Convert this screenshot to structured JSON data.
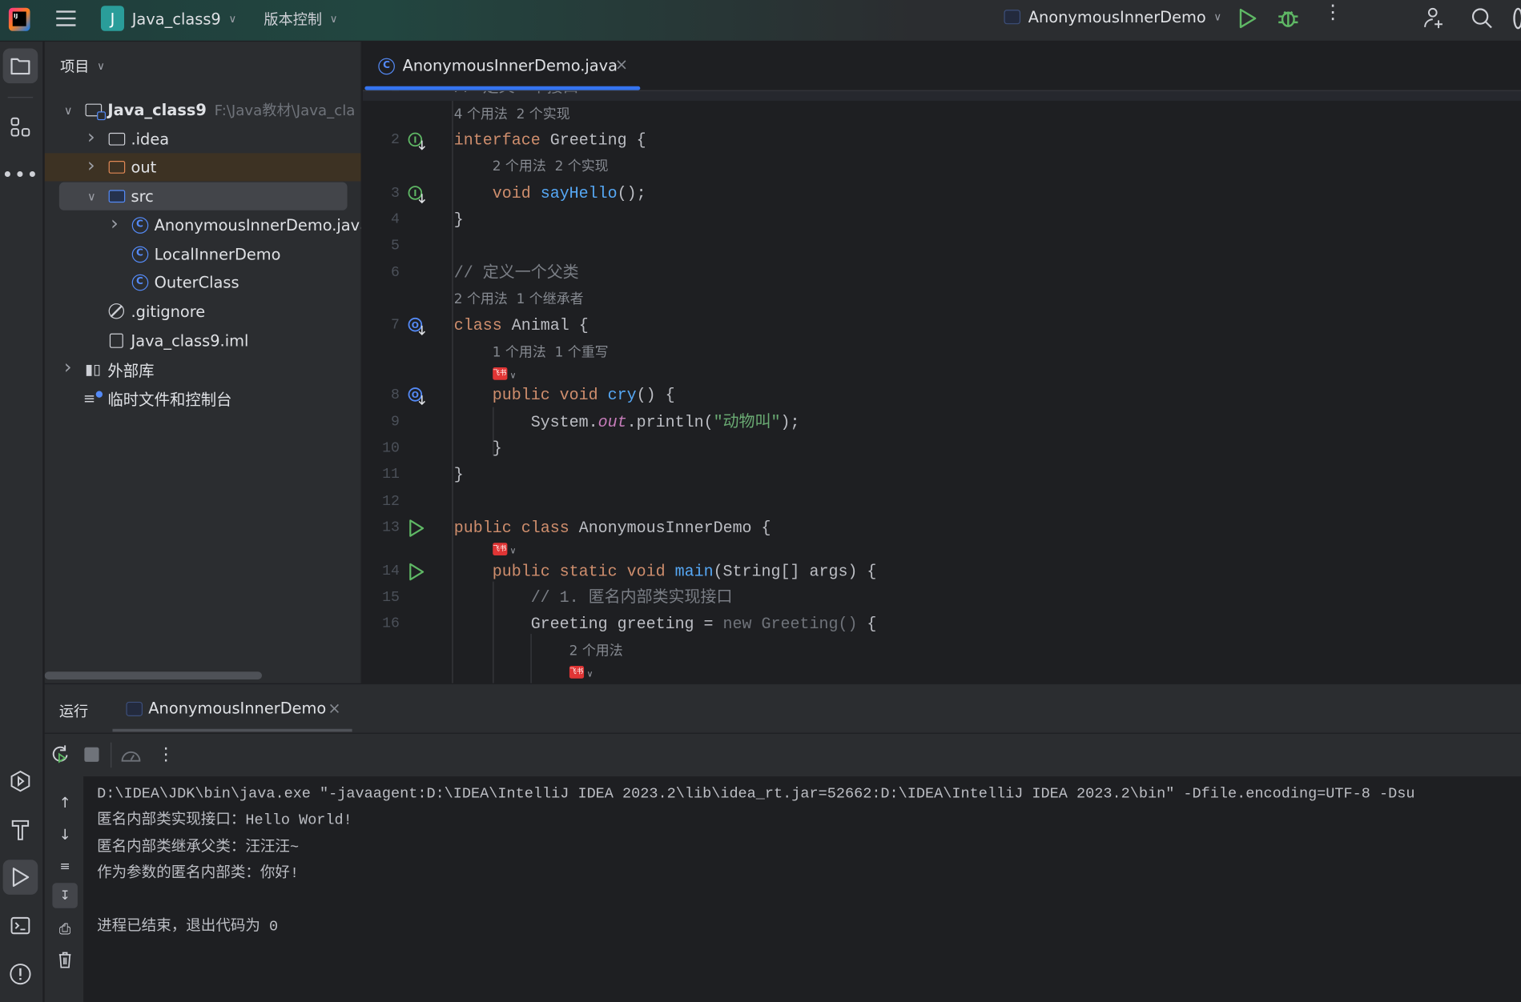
{
  "titlebar": {
    "project_badge": "J",
    "project_name": "Java_class9",
    "vcs_label": "版本控制",
    "run_config": "AnonymousInnerDemo",
    "accent_green": "#5fb865"
  },
  "project_panel": {
    "title": "项目",
    "tree": [
      {
        "label": "Java_class9",
        "path": "F:\\Java教材\\Java_cla",
        "level": 0,
        "expanded": true,
        "icon": "module-folder-icon"
      },
      {
        "label": ".idea",
        "level": 1,
        "expanded": false,
        "icon": "folder-icon"
      },
      {
        "label": "out",
        "level": 1,
        "expanded": false,
        "icon": "excluded-folder-icon",
        "highlight": "excluded"
      },
      {
        "label": "src",
        "level": 1,
        "expanded": true,
        "icon": "source-folder-icon",
        "selected": true
      },
      {
        "label": "AnonymousInnerDemo.java",
        "level": 2,
        "expanded": false,
        "icon": "class-icon",
        "has_children": true
      },
      {
        "label": "LocalInnerDemo",
        "level": 2,
        "icon": "class-icon"
      },
      {
        "label": "OuterClass",
        "level": 2,
        "icon": "class-icon"
      },
      {
        "label": ".gitignore",
        "level": 1,
        "icon": "ignore-file-icon"
      },
      {
        "label": "Java_class9.iml",
        "level": 1,
        "icon": "iml-file-icon"
      },
      {
        "label": "外部库",
        "level": 0,
        "expanded": false,
        "icon": "library-icon"
      },
      {
        "label": "临时文件和控制台",
        "level": 0,
        "icon": "scratches-icon"
      }
    ]
  },
  "editor": {
    "tab_label": "AnonymousInnerDemo.java",
    "rows": [
      {
        "kind": "code",
        "line": "1",
        "indent": 0,
        "tokens": [
          {
            "c": "cm",
            "v": "// 定义一个接口"
          }
        ]
      },
      {
        "kind": "hint",
        "indent": 0,
        "tokens": [
          {
            "c": "hint",
            "v": "4 个用法  2 个实现"
          }
        ]
      },
      {
        "kind": "code",
        "line": "2",
        "gutter": "implemented-icon",
        "indent": 0,
        "tokens": [
          {
            "c": "kw",
            "v": "interface "
          },
          {
            "c": "tx",
            "v": "Greeting {"
          }
        ]
      },
      {
        "kind": "hint",
        "indent": 1,
        "tokens": [
          {
            "c": "hint",
            "v": "2 个用法  2 个实现"
          }
        ]
      },
      {
        "kind": "code",
        "line": "3",
        "gutter": "implemented-icon",
        "indent": 1,
        "tokens": [
          {
            "c": "kw",
            "v": "void "
          },
          {
            "c": "fn",
            "v": "sayHello"
          },
          {
            "c": "tx",
            "v": "();"
          }
        ]
      },
      {
        "kind": "code",
        "line": "4",
        "indent": 0,
        "tokens": [
          {
            "c": "tx",
            "v": "}"
          }
        ]
      },
      {
        "kind": "code",
        "line": "5",
        "indent": 0,
        "tokens": []
      },
      {
        "kind": "code",
        "line": "6",
        "indent": 0,
        "tokens": [
          {
            "c": "cm",
            "v": "// 定义一个父类"
          }
        ]
      },
      {
        "kind": "hint",
        "indent": 0,
        "tokens": [
          {
            "c": "hint",
            "v": "2 个用法  1 个继承者"
          }
        ]
      },
      {
        "kind": "code",
        "line": "7",
        "gutter": "overridden-icon",
        "indent": 0,
        "tokens": [
          {
            "c": "kw",
            "v": "class "
          },
          {
            "c": "tx",
            "v": "Animal {"
          }
        ]
      },
      {
        "kind": "hint",
        "indent": 1,
        "tokens": [
          {
            "c": "hint",
            "v": "1 个用法  1 个重写"
          }
        ]
      },
      {
        "kind": "badge",
        "indent": 1,
        "badge_text": "飞书"
      },
      {
        "kind": "code",
        "line": "8",
        "gutter": "overridden-icon",
        "indent": 1,
        "tokens": [
          {
            "c": "kw",
            "v": "public void "
          },
          {
            "c": "fn",
            "v": "cry"
          },
          {
            "c": "tx",
            "v": "() {"
          }
        ]
      },
      {
        "kind": "code",
        "line": "9",
        "indent": 2,
        "tokens": [
          {
            "c": "tx",
            "v": "System."
          },
          {
            "c": "sf",
            "v": "out"
          },
          {
            "c": "tx",
            "v": ".println("
          },
          {
            "c": "st",
            "v": "\"动物叫\""
          },
          {
            "c": "tx",
            "v": ");"
          }
        ]
      },
      {
        "kind": "code",
        "line": "10",
        "indent": 1,
        "tokens": [
          {
            "c": "tx",
            "v": "}"
          }
        ]
      },
      {
        "kind": "code",
        "line": "11",
        "indent": 0,
        "tokens": [
          {
            "c": "tx",
            "v": "}"
          }
        ]
      },
      {
        "kind": "code",
        "line": "12",
        "indent": 0,
        "tokens": []
      },
      {
        "kind": "code",
        "line": "13",
        "gutter": "run-icon",
        "indent": 0,
        "tokens": [
          {
            "c": "kw",
            "v": "public class "
          },
          {
            "c": "tx",
            "v": "AnonymousInnerDemo {"
          }
        ]
      },
      {
        "kind": "badge",
        "indent": 1,
        "badge_text": "飞书"
      },
      {
        "kind": "code",
        "line": "14",
        "gutter": "run-icon",
        "indent": 1,
        "tokens": [
          {
            "c": "kw",
            "v": "public static void "
          },
          {
            "c": "fn",
            "v": "main"
          },
          {
            "c": "tx",
            "v": "(String[] args) {"
          }
        ]
      },
      {
        "kind": "code",
        "line": "15",
        "indent": 2,
        "tokens": [
          {
            "c": "cm",
            "v": "// 1. 匿名内部类实现接口"
          }
        ]
      },
      {
        "kind": "code",
        "line": "16",
        "indent": 2,
        "tokens": [
          {
            "c": "tx",
            "v": "Greeting greeting = "
          },
          {
            "c": "dim",
            "v": "new Greeting() "
          },
          {
            "c": "tx",
            "v": "{"
          }
        ]
      },
      {
        "kind": "hint",
        "indent": 3,
        "tokens": [
          {
            "c": "hint",
            "v": "2 个用法"
          }
        ]
      },
      {
        "kind": "badge",
        "indent": 3,
        "badge_text": "飞书"
      }
    ]
  },
  "run_panel": {
    "title": "运行",
    "tab_label": "AnonymousInnerDemo",
    "console": [
      "D:\\IDEA\\JDK\\bin\\java.exe \"-javaagent:D:\\IDEA\\IntelliJ IDEA 2023.2\\lib\\idea_rt.jar=52662:D:\\IDEA\\IntelliJ IDEA 2023.2\\bin\" -Dfile.encoding=UTF-8 -Dsu",
      "匿名内部类实现接口：Hello World!",
      "匿名内部类继承父类：汪汪汪~",
      "作为参数的匿名内部类：你好!",
      "",
      "进程已结束，退出代码为 0"
    ]
  }
}
